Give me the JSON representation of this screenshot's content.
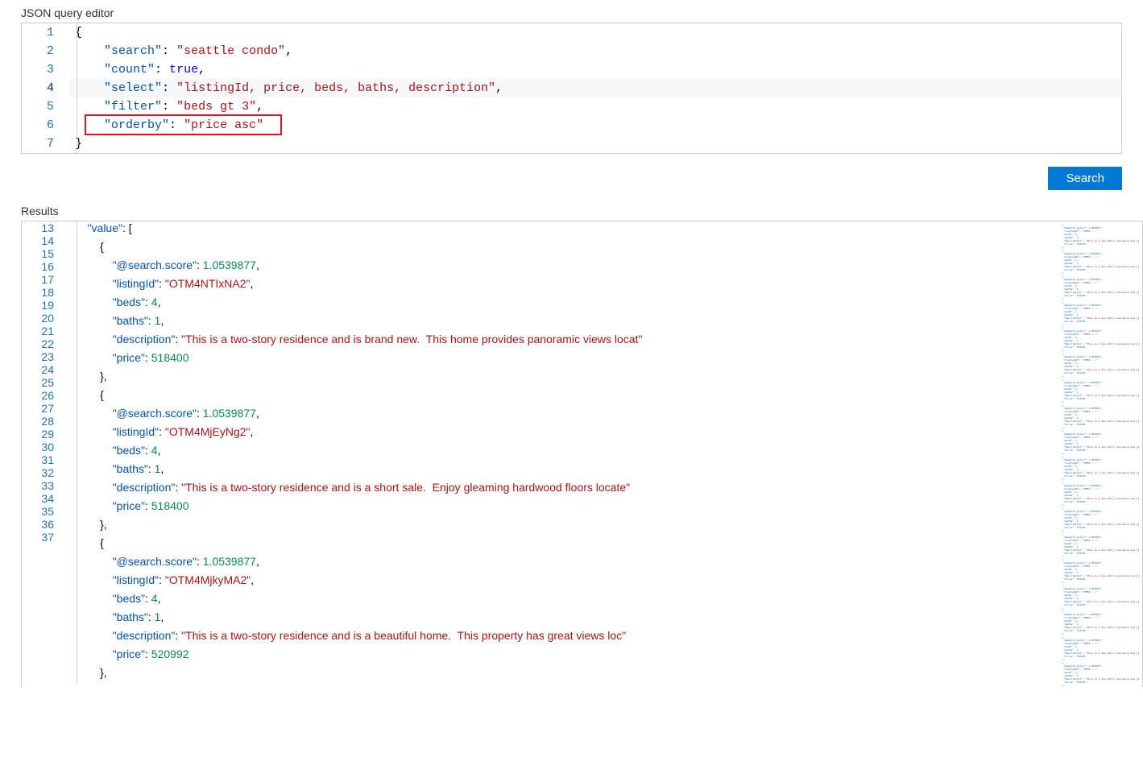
{
  "labels": {
    "editor_title": "JSON query editor",
    "results_title": "Results",
    "search_button": "Search"
  },
  "query": {
    "search": "seattle condo",
    "count": true,
    "select": "listingId, price, beds, baths, description",
    "filter": "beds gt 3",
    "orderby": "price asc"
  },
  "query_editor": {
    "line_numbers": [
      "1",
      "2",
      "3",
      "4",
      "5",
      "6",
      "7"
    ],
    "active_line": 4,
    "highlighted_line": 6
  },
  "results_editor": {
    "line_numbers": [
      "13",
      "14",
      "15",
      "16",
      "17",
      "18",
      "19",
      "20",
      "21",
      "22",
      "23",
      "24",
      "25",
      "26",
      "27",
      "28",
      "29",
      "30",
      "31",
      "32",
      "33",
      "34",
      "35",
      "36",
      "37"
    ]
  },
  "results": {
    "value": [
      {
        "@search.score": 1.0539877,
        "listingId": "OTM4NTIxNA2",
        "beds": 4,
        "baths": 1,
        "description": "This is a two-story residence and is brand new.  This home provides panoramic views locat",
        "price": 518400
      },
      {
        "@search.score": 1.0539877,
        "listingId": "OTM4MjEyNg2",
        "beds": 4,
        "baths": 1,
        "description": "This is a two-story residence and is a short sale.  Enjoy gleaming hardwood floors locate",
        "price": 518400
      },
      {
        "@search.score": 1.0539877,
        "listingId": "OTM4MjkyMA2",
        "beds": 4,
        "baths": 1,
        "description": "This is a two-story residence and is a beautiful home.  This property has great views loc",
        "price": 520992
      }
    ]
  }
}
